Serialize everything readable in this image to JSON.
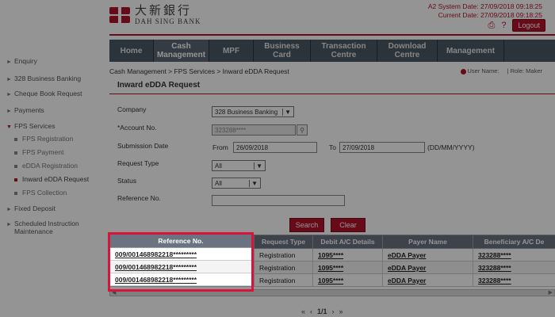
{
  "logo": {
    "cn": "大新銀行",
    "en": "DAH SING BANK",
    "alt": "Dah Sing Bank logo"
  },
  "system": {
    "a2_date": "A2 System Date: 27/09/2018 09:18:25",
    "current_date": "Current Date: 27/09/2018 09:18:25",
    "logout": "Logout",
    "help": "?"
  },
  "nav": [
    {
      "label": "Home"
    },
    {
      "label": "Cash Management"
    },
    {
      "label": "MPF"
    },
    {
      "label": "Business Card"
    },
    {
      "label": "Transaction Centre"
    },
    {
      "label": "Download Centre"
    },
    {
      "label": "Management"
    }
  ],
  "breadcrumb": "Cash Management > FPS Services > Inward eDDA Request",
  "user": {
    "user_name": "User Name:",
    "role": "| Role: Maker"
  },
  "sidebar": {
    "items": [
      {
        "label": "Enquiry",
        "arrow": "►"
      },
      {
        "label": "328 Business Banking",
        "arrow": "►"
      },
      {
        "label": "Cheque Book Request",
        "arrow": "►"
      },
      {
        "label": "Payments",
        "arrow": "►"
      },
      {
        "label": "FPS Services",
        "arrow": "▼"
      },
      {
        "label": "Fixed Deposit",
        "arrow": "►"
      },
      {
        "label": "Scheduled Instruction",
        "arrow": "►"
      },
      {
        "label": "Maintenance",
        "arrow": ""
      }
    ],
    "sub": [
      {
        "label": "FPS Registration"
      },
      {
        "label": "FPS Payment"
      },
      {
        "label": "eDDA Registration"
      },
      {
        "label": "Inward eDDA Request"
      },
      {
        "label": "FPS Collection"
      }
    ]
  },
  "form": {
    "title": "Inward eDDA Request",
    "company_label": "Company",
    "company_value": "328 Business Banking",
    "account_label": "*Account No.",
    "account_value": "323288****",
    "submission_label": "Submission Date",
    "from_label": "From",
    "from_value": "26/09/2018",
    "to_label": "To",
    "to_value": "27/09/2018",
    "date_format": "(DD/MM/YYYY)",
    "request_type_label": "Request Type",
    "request_type_value": "All",
    "status_label": "Status",
    "status_value": "All",
    "reference_label": "Reference No.",
    "reference_value": "",
    "search": "Search",
    "clear": "Clear"
  },
  "table": {
    "headers": [
      "Reference No.",
      "Request Type",
      "Debit A/C Details",
      "Payer Name",
      "Beneficiary A/C De"
    ],
    "rows": [
      [
        "009/001468982218*********",
        "Registration",
        "1095****",
        "eDDA Payer",
        "323288****"
      ],
      [
        "009/001468982218*********",
        "Registration",
        "1095****",
        "eDDA Payer",
        "323288****"
      ],
      [
        "009/001468982218*********",
        "Registration",
        "1095****",
        "eDDA Payer",
        "323288****"
      ]
    ]
  },
  "pager": {
    "first": "«",
    "prev": "‹",
    "page": "1/1",
    "next": "›",
    "last": "»"
  },
  "colors": {
    "brand": "#b3132b",
    "highlight": "#d9143a",
    "nav": "#4b5966"
  },
  "icons": [
    "print-icon",
    "help-icon",
    "user-icon",
    "magnifier-icon"
  ]
}
